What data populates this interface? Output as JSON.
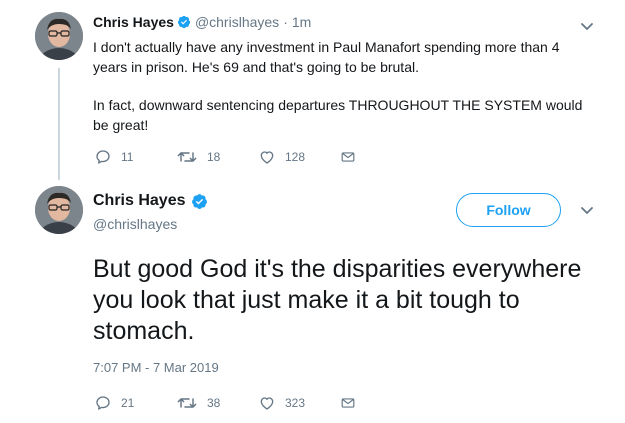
{
  "tweet_reply": {
    "author_name": "Chris Hayes",
    "handle": "@chrislhayes",
    "time_sep": "·",
    "time": "1m",
    "text_paragraphs": [
      "I don't actually have any investment in Paul Manafort spending more than 4 years in prison. He's 69 and that's going to be brutal.",
      "In fact, downward sentencing departures THROUGHOUT THE SYSTEM would be great!"
    ],
    "replies": "11",
    "retweets": "18",
    "likes": "128"
  },
  "tweet_main": {
    "author_name": "Chris Hayes",
    "handle": "@chrislhayes",
    "follow_label": "Follow",
    "text": "But good God it's the disparities everywhere you look that just make it a bit tough to stomach.",
    "timestamp": "7:07 PM - 7 Mar 2019",
    "replies": "21",
    "retweets": "38",
    "likes": "323"
  },
  "colors": {
    "accent": "#1da1f2",
    "muted": "#657786",
    "thread_line": "#ccd6dd"
  },
  "icons": [
    "verified-badge-icon",
    "chevron-down-icon",
    "reply-icon",
    "retweet-icon",
    "like-icon",
    "message-icon"
  ]
}
